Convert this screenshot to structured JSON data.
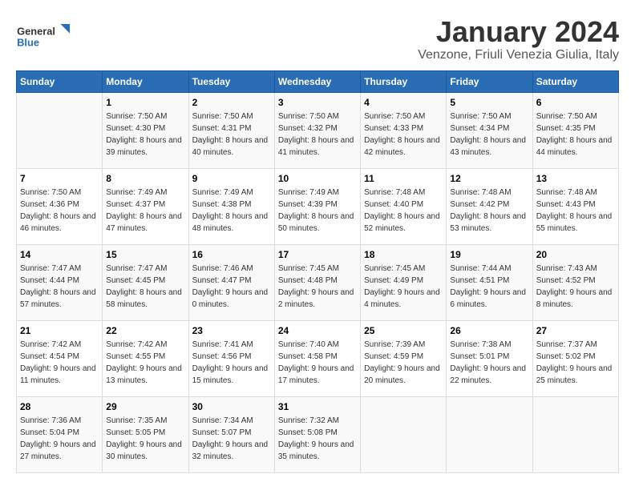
{
  "header": {
    "logo_general": "General",
    "logo_blue": "Blue",
    "title": "January 2024",
    "subtitle": "Venzone, Friuli Venezia Giulia, Italy"
  },
  "weekdays": [
    "Sunday",
    "Monday",
    "Tuesday",
    "Wednesday",
    "Thursday",
    "Friday",
    "Saturday"
  ],
  "weeks": [
    [
      {
        "day": "",
        "sunrise": "",
        "sunset": "",
        "daylight": ""
      },
      {
        "day": "1",
        "sunrise": "Sunrise: 7:50 AM",
        "sunset": "Sunset: 4:30 PM",
        "daylight": "Daylight: 8 hours and 39 minutes."
      },
      {
        "day": "2",
        "sunrise": "Sunrise: 7:50 AM",
        "sunset": "Sunset: 4:31 PM",
        "daylight": "Daylight: 8 hours and 40 minutes."
      },
      {
        "day": "3",
        "sunrise": "Sunrise: 7:50 AM",
        "sunset": "Sunset: 4:32 PM",
        "daylight": "Daylight: 8 hours and 41 minutes."
      },
      {
        "day": "4",
        "sunrise": "Sunrise: 7:50 AM",
        "sunset": "Sunset: 4:33 PM",
        "daylight": "Daylight: 8 hours and 42 minutes."
      },
      {
        "day": "5",
        "sunrise": "Sunrise: 7:50 AM",
        "sunset": "Sunset: 4:34 PM",
        "daylight": "Daylight: 8 hours and 43 minutes."
      },
      {
        "day": "6",
        "sunrise": "Sunrise: 7:50 AM",
        "sunset": "Sunset: 4:35 PM",
        "daylight": "Daylight: 8 hours and 44 minutes."
      }
    ],
    [
      {
        "day": "7",
        "sunrise": "Sunrise: 7:50 AM",
        "sunset": "Sunset: 4:36 PM",
        "daylight": "Daylight: 8 hours and 46 minutes."
      },
      {
        "day": "8",
        "sunrise": "Sunrise: 7:49 AM",
        "sunset": "Sunset: 4:37 PM",
        "daylight": "Daylight: 8 hours and 47 minutes."
      },
      {
        "day": "9",
        "sunrise": "Sunrise: 7:49 AM",
        "sunset": "Sunset: 4:38 PM",
        "daylight": "Daylight: 8 hours and 48 minutes."
      },
      {
        "day": "10",
        "sunrise": "Sunrise: 7:49 AM",
        "sunset": "Sunset: 4:39 PM",
        "daylight": "Daylight: 8 hours and 50 minutes."
      },
      {
        "day": "11",
        "sunrise": "Sunrise: 7:48 AM",
        "sunset": "Sunset: 4:40 PM",
        "daylight": "Daylight: 8 hours and 52 minutes."
      },
      {
        "day": "12",
        "sunrise": "Sunrise: 7:48 AM",
        "sunset": "Sunset: 4:42 PM",
        "daylight": "Daylight: 8 hours and 53 minutes."
      },
      {
        "day": "13",
        "sunrise": "Sunrise: 7:48 AM",
        "sunset": "Sunset: 4:43 PM",
        "daylight": "Daylight: 8 hours and 55 minutes."
      }
    ],
    [
      {
        "day": "14",
        "sunrise": "Sunrise: 7:47 AM",
        "sunset": "Sunset: 4:44 PM",
        "daylight": "Daylight: 8 hours and 57 minutes."
      },
      {
        "day": "15",
        "sunrise": "Sunrise: 7:47 AM",
        "sunset": "Sunset: 4:45 PM",
        "daylight": "Daylight: 8 hours and 58 minutes."
      },
      {
        "day": "16",
        "sunrise": "Sunrise: 7:46 AM",
        "sunset": "Sunset: 4:47 PM",
        "daylight": "Daylight: 9 hours and 0 minutes."
      },
      {
        "day": "17",
        "sunrise": "Sunrise: 7:45 AM",
        "sunset": "Sunset: 4:48 PM",
        "daylight": "Daylight: 9 hours and 2 minutes."
      },
      {
        "day": "18",
        "sunrise": "Sunrise: 7:45 AM",
        "sunset": "Sunset: 4:49 PM",
        "daylight": "Daylight: 9 hours and 4 minutes."
      },
      {
        "day": "19",
        "sunrise": "Sunrise: 7:44 AM",
        "sunset": "Sunset: 4:51 PM",
        "daylight": "Daylight: 9 hours and 6 minutes."
      },
      {
        "day": "20",
        "sunrise": "Sunrise: 7:43 AM",
        "sunset": "Sunset: 4:52 PM",
        "daylight": "Daylight: 9 hours and 8 minutes."
      }
    ],
    [
      {
        "day": "21",
        "sunrise": "Sunrise: 7:42 AM",
        "sunset": "Sunset: 4:54 PM",
        "daylight": "Daylight: 9 hours and 11 minutes."
      },
      {
        "day": "22",
        "sunrise": "Sunrise: 7:42 AM",
        "sunset": "Sunset: 4:55 PM",
        "daylight": "Daylight: 9 hours and 13 minutes."
      },
      {
        "day": "23",
        "sunrise": "Sunrise: 7:41 AM",
        "sunset": "Sunset: 4:56 PM",
        "daylight": "Daylight: 9 hours and 15 minutes."
      },
      {
        "day": "24",
        "sunrise": "Sunrise: 7:40 AM",
        "sunset": "Sunset: 4:58 PM",
        "daylight": "Daylight: 9 hours and 17 minutes."
      },
      {
        "day": "25",
        "sunrise": "Sunrise: 7:39 AM",
        "sunset": "Sunset: 4:59 PM",
        "daylight": "Daylight: 9 hours and 20 minutes."
      },
      {
        "day": "26",
        "sunrise": "Sunrise: 7:38 AM",
        "sunset": "Sunset: 5:01 PM",
        "daylight": "Daylight: 9 hours and 22 minutes."
      },
      {
        "day": "27",
        "sunrise": "Sunrise: 7:37 AM",
        "sunset": "Sunset: 5:02 PM",
        "daylight": "Daylight: 9 hours and 25 minutes."
      }
    ],
    [
      {
        "day": "28",
        "sunrise": "Sunrise: 7:36 AM",
        "sunset": "Sunset: 5:04 PM",
        "daylight": "Daylight: 9 hours and 27 minutes."
      },
      {
        "day": "29",
        "sunrise": "Sunrise: 7:35 AM",
        "sunset": "Sunset: 5:05 PM",
        "daylight": "Daylight: 9 hours and 30 minutes."
      },
      {
        "day": "30",
        "sunrise": "Sunrise: 7:34 AM",
        "sunset": "Sunset: 5:07 PM",
        "daylight": "Daylight: 9 hours and 32 minutes."
      },
      {
        "day": "31",
        "sunrise": "Sunrise: 7:32 AM",
        "sunset": "Sunset: 5:08 PM",
        "daylight": "Daylight: 9 hours and 35 minutes."
      },
      {
        "day": "",
        "sunrise": "",
        "sunset": "",
        "daylight": ""
      },
      {
        "day": "",
        "sunrise": "",
        "sunset": "",
        "daylight": ""
      },
      {
        "day": "",
        "sunrise": "",
        "sunset": "",
        "daylight": ""
      }
    ]
  ]
}
